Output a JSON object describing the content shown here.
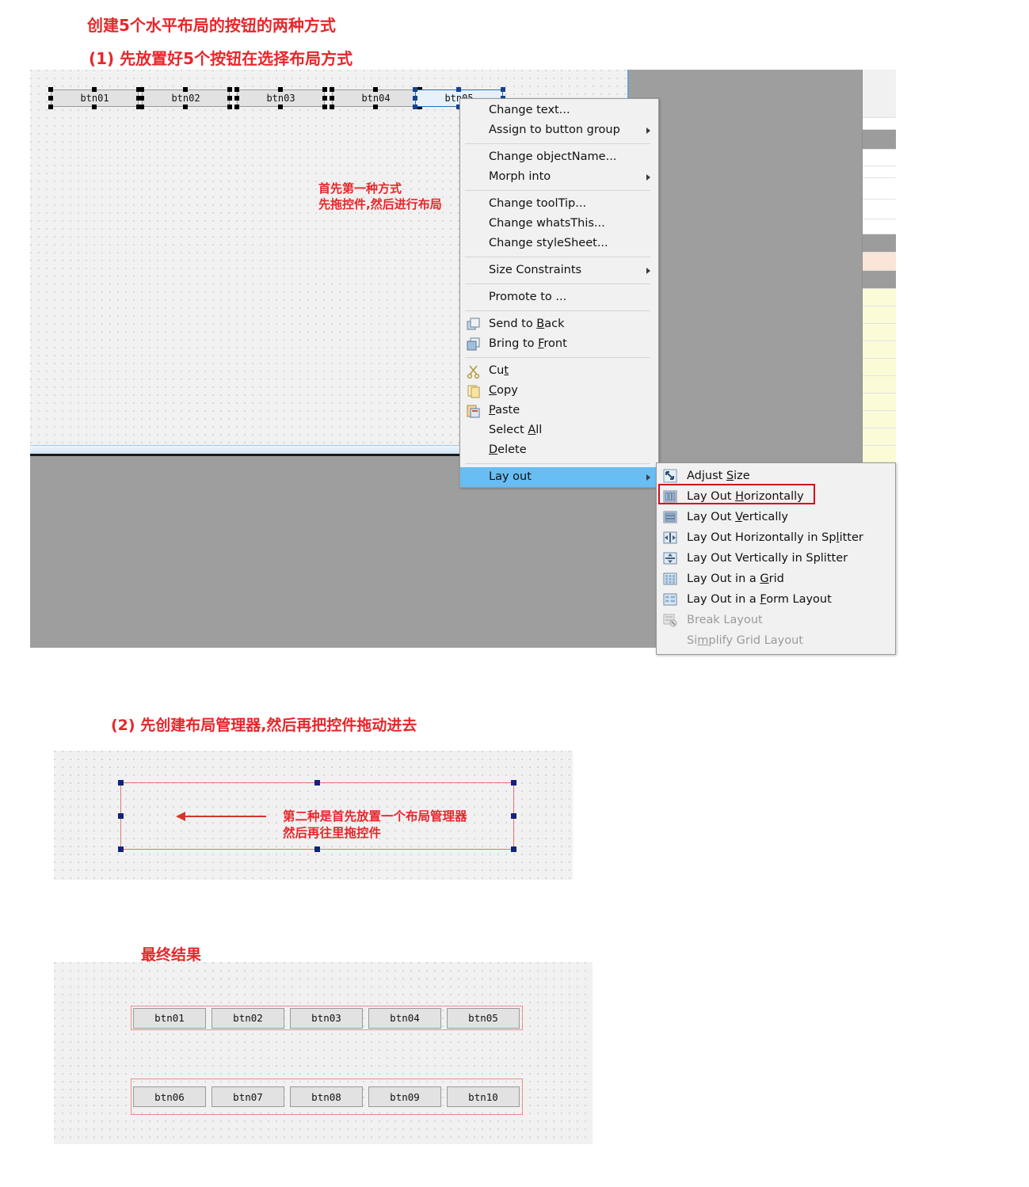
{
  "headings": {
    "title": "创建5个水平布局的按钮的两种方式",
    "step1": "(1) 先放置好5个按钮在选择布局方式",
    "step2": "(2) 先创建布局管理器,然后再把控件拖动进去",
    "final": "最终结果"
  },
  "annotations": {
    "method1": "首先第一种方式\n先拖控件,然后进行布局",
    "method2": "第二种是首先放置一个布局管理器\n然后再往里拖控件"
  },
  "designer": {
    "top_buttons": [
      "btn01",
      "btn02",
      "btn03",
      "btn04",
      "btn05"
    ],
    "selected_button": "btn05"
  },
  "context_menu": {
    "items": [
      {
        "label": "Change text...",
        "submenu": false,
        "icon": "",
        "disabled": false
      },
      {
        "label": "Assign to button group",
        "submenu": true,
        "icon": "",
        "disabled": false
      },
      {
        "separator": true
      },
      {
        "label": "Change objectName...",
        "submenu": false,
        "icon": "",
        "disabled": false
      },
      {
        "label": "Morph into",
        "submenu": true,
        "icon": "",
        "disabled": false
      },
      {
        "separator": true
      },
      {
        "label": "Change toolTip...",
        "submenu": false,
        "icon": "",
        "disabled": false
      },
      {
        "label": "Change whatsThis...",
        "submenu": false,
        "icon": "",
        "disabled": false
      },
      {
        "label": "Change styleSheet...",
        "submenu": false,
        "icon": "",
        "disabled": false
      },
      {
        "separator": true
      },
      {
        "label": "Size Constraints",
        "submenu": true,
        "icon": "",
        "disabled": false
      },
      {
        "separator": true
      },
      {
        "label": "Promote to ...",
        "submenu": false,
        "icon": "",
        "disabled": false
      },
      {
        "separator": true
      },
      {
        "label": "Send to Back",
        "submenu": false,
        "icon": "send-to-back-icon",
        "disabled": false,
        "mnemonic": "B"
      },
      {
        "label": "Bring to Front",
        "submenu": false,
        "icon": "bring-to-front-icon",
        "disabled": false,
        "mnemonic": "F"
      },
      {
        "separator": true
      },
      {
        "label": "Cut",
        "submenu": false,
        "icon": "scissors-icon",
        "disabled": false,
        "mnemonic": "t"
      },
      {
        "label": "Copy",
        "submenu": false,
        "icon": "copy-icon",
        "disabled": false,
        "mnemonic": "C"
      },
      {
        "label": "Paste",
        "submenu": false,
        "icon": "paste-icon",
        "disabled": false,
        "mnemonic": "P"
      },
      {
        "label": "Select All",
        "submenu": false,
        "icon": "",
        "disabled": false,
        "mnemonic": "A"
      },
      {
        "label": "Delete",
        "submenu": false,
        "icon": "",
        "disabled": false,
        "mnemonic": "D"
      },
      {
        "separator": true
      },
      {
        "label": "Lay out",
        "submenu": true,
        "icon": "",
        "disabled": false,
        "highlighted": true
      }
    ]
  },
  "layout_submenu": {
    "items": [
      {
        "label": "Adjust Size",
        "icon": "adjust-size-icon",
        "disabled": false,
        "mnemonic": "S"
      },
      {
        "label": "Lay Out Horizontally",
        "icon": "lay-out-horizontally-icon",
        "disabled": false,
        "mnemonic": "H",
        "outlined": true
      },
      {
        "label": "Lay Out Vertically",
        "icon": "lay-out-vertically-icon",
        "disabled": false,
        "mnemonic": "V"
      },
      {
        "label": "Lay Out Horizontally in Splitter",
        "icon": "h-splitter-icon",
        "disabled": false,
        "mnemonic": "l"
      },
      {
        "label": "Lay Out Vertically in Splitter",
        "icon": "v-splitter-icon",
        "disabled": false,
        "mnemonic": ""
      },
      {
        "label": "Lay Out in a Grid",
        "icon": "grid-layout-icon",
        "disabled": false,
        "mnemonic": "G"
      },
      {
        "label": "Lay Out in a Form Layout",
        "icon": "form-layout-icon",
        "disabled": false,
        "mnemonic": "F"
      },
      {
        "label": "Break Layout",
        "icon": "break-layout-icon",
        "disabled": true,
        "mnemonic": ""
      },
      {
        "label": "Simplify Grid Layout",
        "icon": "",
        "disabled": true,
        "mnemonic": "m"
      }
    ]
  },
  "final_result": {
    "row1": [
      "btn01",
      "btn02",
      "btn03",
      "btn04",
      "btn05"
    ],
    "row2": [
      "btn06",
      "btn07",
      "btn08",
      "btn09",
      "btn10"
    ]
  },
  "colors": {
    "annotation_red": "#e8262b",
    "highlight_blue": "#68bdf2",
    "outline_red": "#d40b17",
    "layout_border": "#e4736f",
    "handle_blue": "#14237a",
    "canvas_bg": "#f1f1f1",
    "designer_bg": "#9e9e9e"
  }
}
